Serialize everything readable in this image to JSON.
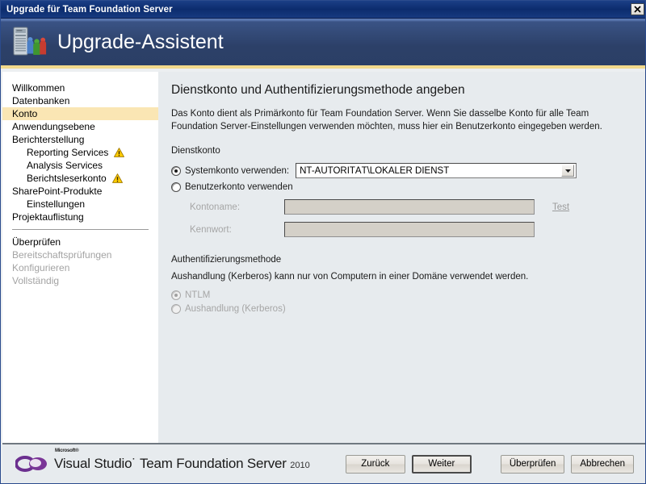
{
  "window": {
    "title": "Upgrade für Team Foundation Server",
    "close_icon": "close-icon"
  },
  "header": {
    "title": "Upgrade-Assistent",
    "icon": "server-team-icon"
  },
  "sidebar": {
    "items": [
      {
        "label": "Willkommen",
        "indent": false,
        "state": "normal",
        "warning": false
      },
      {
        "label": "Datenbanken",
        "indent": false,
        "state": "normal",
        "warning": false
      },
      {
        "label": "Konto",
        "indent": false,
        "state": "active",
        "warning": false
      },
      {
        "label": "Anwendungsebene",
        "indent": false,
        "state": "normal",
        "warning": false
      },
      {
        "label": "Berichterstellung",
        "indent": false,
        "state": "normal",
        "warning": false
      },
      {
        "label": "Reporting Services",
        "indent": true,
        "state": "normal",
        "warning": true
      },
      {
        "label": "Analysis Services",
        "indent": true,
        "state": "normal",
        "warning": false
      },
      {
        "label": "Berichtsleserkonto",
        "indent": true,
        "state": "normal",
        "warning": true
      },
      {
        "label": "SharePoint-Produkte",
        "indent": false,
        "state": "normal",
        "warning": false
      },
      {
        "label": "Einstellungen",
        "indent": true,
        "state": "normal",
        "warning": false
      },
      {
        "label": "Projektauflistung",
        "indent": false,
        "state": "normal",
        "warning": false
      }
    ],
    "items2": [
      {
        "label": "Überprüfen",
        "indent": false,
        "state": "normal",
        "warning": false
      },
      {
        "label": "Bereitschaftsprüfungen",
        "indent": false,
        "state": "disabled",
        "warning": false
      },
      {
        "label": "Konfigurieren",
        "indent": false,
        "state": "disabled",
        "warning": false
      },
      {
        "label": "Vollständig",
        "indent": false,
        "state": "disabled",
        "warning": false
      }
    ]
  },
  "main": {
    "heading": "Dienstkonto und Authentifizierungsmethode angeben",
    "description": "Das Konto dient als Primärkonto für Team Foundation Server. Wenn Sie dasselbe Konto für alle Team Foundation Server-Einstellungen verwenden möchten, muss hier ein Benutzerkonto eingegeben werden.",
    "service_account": {
      "section_label": "Dienstkonto",
      "system_account_radio_label": "Systemkonto verwenden:",
      "system_account_value": "NT-AUTORITÄT\\LOKALER DIENST",
      "user_account_radio_label": "Benutzerkonto verwenden",
      "account_name_label": "Kontoname:",
      "account_name_value": "",
      "password_label": "Kennwort:",
      "password_value": "",
      "test_link_label": "Test"
    },
    "auth_method": {
      "section_label": "Authentifizierungsmethode",
      "note": "Aushandlung (Kerberos) kann nur von Computern in einer Domäne verwendet werden.",
      "ntlm_label": "NTLM",
      "kerberos_label": "Aushandlung (Kerberos)"
    }
  },
  "footer": {
    "brand_microsoft": "Microsoft®",
    "brand_product": "Visual Studio˙ Team Foundation Server",
    "brand_year": "2010",
    "buttons": {
      "back": "Zurück",
      "next": "Weiter",
      "verify": "Überprüfen",
      "cancel": "Abbrechen"
    }
  },
  "colors": {
    "titlebar": "#0c2c6e",
    "header_gradient_top": "#3a5385",
    "header_accent": "#f2d98b",
    "active_nav": "#fae6b4",
    "content_bg": "#e7ebee",
    "warning": "#ffcc00"
  }
}
